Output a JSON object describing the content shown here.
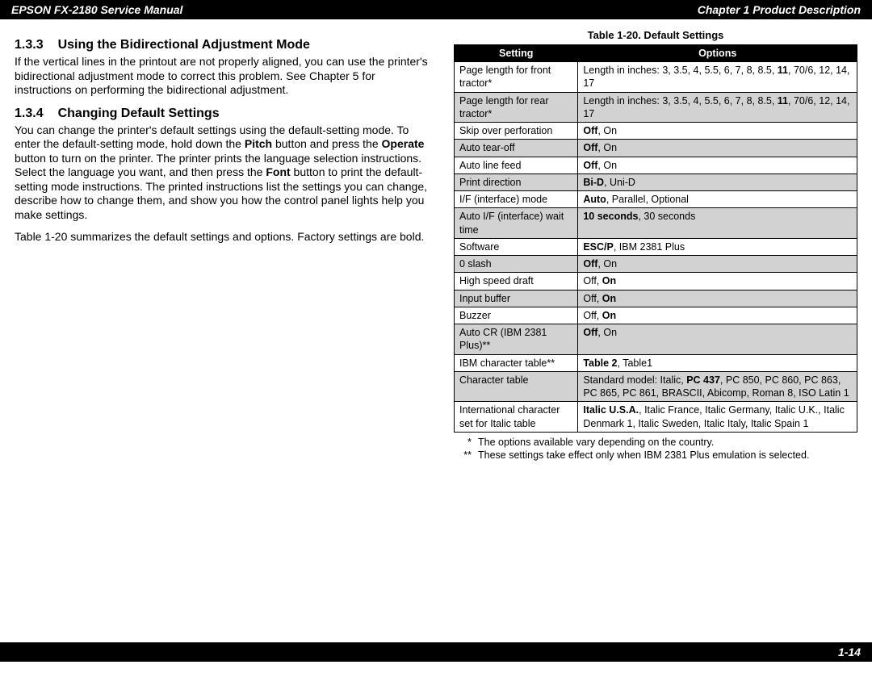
{
  "header": {
    "left": "EPSON FX-2180 Service Manual",
    "right": "Chapter 1  Product Description"
  },
  "footer": {
    "page_num": "1-14"
  },
  "left": {
    "sec1_num": "1.3.3",
    "sec1_title": "Using the Bidirectional Adjustment Mode",
    "sec1_para": "If the vertical lines in the printout are not properly aligned, you can use the printer's bidirectional adjustment mode to correct this problem. See Chapter 5 for instructions on performing the bidirectional adjustment.",
    "sec2_num": "1.3.4",
    "sec2_title": "Changing Default Settings",
    "sec2_para1_a": "You can change the printer's default settings using the default-setting mode. To enter the default-setting mode, hold down the ",
    "sec2_para1_b": "Pitch",
    "sec2_para1_c": " button and press the ",
    "sec2_para1_d": "Operate",
    "sec2_para1_e": " button to turn on the printer. The printer prints the language selection instructions. Select the language you want, and then press the ",
    "sec2_para1_f": "Font",
    "sec2_para1_g": " button to print the default-setting mode instructions. The printed instructions list the settings you can change, describe how to change them, and show you how the control panel lights help you make settings.",
    "sec2_para2": "Table 1-20 summarizes the default settings and options. Factory settings are bold."
  },
  "table": {
    "caption": "Table 1-20. Default Settings",
    "col1": "Setting",
    "col2": "Options",
    "rows": [
      {
        "shade": false,
        "s": "Page length for front tractor*",
        "o_pre": "Length in inches: 3, 3.5, 4, 5.5, 6, 7, 8, 8.5, ",
        "o_bold": "11",
        "o_post": ", 70/6, 12, 14, 17"
      },
      {
        "shade": true,
        "s": "Page length for rear tractor*",
        "o_pre": "Length in inches: 3, 3.5, 4, 5.5, 6, 7, 8, 8.5, ",
        "o_bold": "11",
        "o_post": ", 70/6, 12, 14, 17"
      },
      {
        "shade": false,
        "s": "Skip over perforation",
        "o_bold": "Off",
        "o_post": ", On"
      },
      {
        "shade": true,
        "s": "Auto tear-off",
        "o_bold": "Off",
        "o_post": ", On"
      },
      {
        "shade": false,
        "s": "Auto line feed",
        "o_bold": "Off",
        "o_post": ", On"
      },
      {
        "shade": true,
        "s": "Print direction",
        "o_bold": "Bi-D",
        "o_post": ", Uni-D"
      },
      {
        "shade": false,
        "s": "I/F (interface) mode",
        "o_bold": "Auto",
        "o_post": ", Parallel, Optional"
      },
      {
        "shade": true,
        "s": "Auto I/F (interface) wait time",
        "o_bold": "10 seconds",
        "o_post": ", 30 seconds"
      },
      {
        "shade": false,
        "s": "Software",
        "o_bold": "ESC/P",
        "o_post": ", IBM 2381 Plus"
      },
      {
        "shade": true,
        "s": "0 slash",
        "o_bold": "Off",
        "o_post": ", On"
      },
      {
        "shade": false,
        "s": "High speed draft",
        "o_pre": "Off, ",
        "o_bold": "On"
      },
      {
        "shade": true,
        "s": "Input buffer",
        "o_pre": "Off, ",
        "o_bold": "On"
      },
      {
        "shade": false,
        "s": "Buzzer",
        "o_pre": "Off, ",
        "o_bold": "On"
      },
      {
        "shade": true,
        "s": "Auto CR (IBM 2381 Plus)**",
        "o_bold": "Off",
        "o_post": ", On"
      },
      {
        "shade": false,
        "s": "IBM character table**",
        "o_bold": "Table 2",
        "o_post": ", Table1"
      },
      {
        "shade": true,
        "s": "Character table",
        "o_pre": "Standard model: Italic, ",
        "o_bold": "PC 437",
        "o_post": ", PC 850, PC 860, PC 863, PC 865, PC 861, BRASCII, Abicomp, Roman 8, ISO Latin 1"
      },
      {
        "shade": false,
        "s": "International character set for Italic table",
        "o_bold": "Italic U.S.A.",
        "o_post": ", Italic France, Italic Germany, Italic U.K., Italic Denmark 1, Italic Sweden, Italic Italy, Italic Spain 1"
      }
    ],
    "footnote1_mark": "*",
    "footnote1": "The options available vary depending on the country.",
    "footnote2_mark": "**",
    "footnote2": "These settings take effect only when IBM 2381 Plus emulation is selected."
  }
}
